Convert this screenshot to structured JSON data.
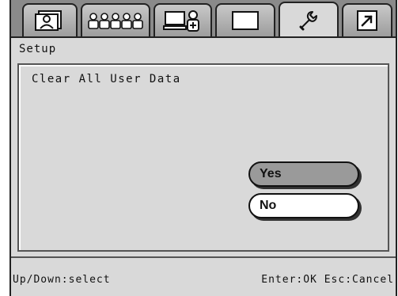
{
  "tabs": [
    {
      "icon": "contacts-card-icon",
      "active": false
    },
    {
      "icon": "group-users-icon",
      "active": false
    },
    {
      "icon": "add-user-computer-icon",
      "active": false
    },
    {
      "icon": "blank-screen-icon",
      "active": false
    },
    {
      "icon": "wrench-icon",
      "active": true
    },
    {
      "icon": "arrow-exit-icon",
      "active": false
    }
  ],
  "header": {
    "title": "Setup"
  },
  "dialog": {
    "prompt": "Clear All User Data",
    "yes_label": "Yes",
    "no_label": "No",
    "selected": "Yes"
  },
  "status": {
    "left": "Up/Down:select",
    "right": "Enter:OK Esc:Cancel"
  }
}
